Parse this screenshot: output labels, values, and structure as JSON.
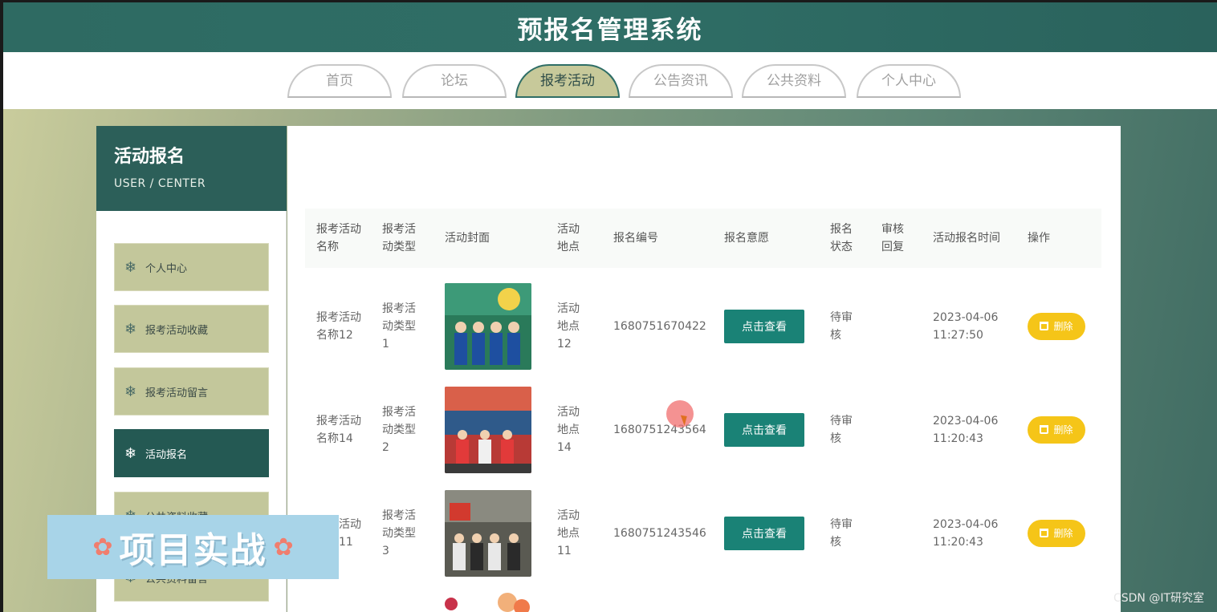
{
  "header": {
    "title": "预报名管理系统"
  },
  "nav": {
    "tabs": [
      "首页",
      "论坛",
      "报考活动",
      "公告资讯",
      "公共资料",
      "个人中心"
    ],
    "active": "报考活动"
  },
  "sidebar": {
    "title": "活动报名",
    "subtitle": "USER / CENTER",
    "items": [
      "个人中心",
      "报考活动收藏",
      "报考活动留言",
      "活动报名",
      "公共资料收藏",
      "公共资料留言"
    ],
    "active": "活动报名"
  },
  "table": {
    "headers": [
      "报考活动名称",
      "报考活动类型",
      "活动封面",
      "活动地点",
      "报名编号",
      "报名意愿",
      "报名状态",
      "审核回复",
      "活动报名时间",
      "操作"
    ],
    "view_label": "点击查看",
    "delete_label": "删除",
    "rows": [
      {
        "name": "报考活动名称12",
        "type": "报考活动类型1",
        "place": "活动地点12",
        "no": "1680751670422",
        "status": "待审核",
        "reply": "",
        "date": "2023-04-06",
        "time": "11:27:50"
      },
      {
        "name": "报考活动名称14",
        "type": "报考活动类型2",
        "place": "活动地点14",
        "no": "1680751243564",
        "status": "待审核",
        "reply": "",
        "date": "2023-04-06",
        "time": "11:20:43"
      },
      {
        "name": "报考活动名称11",
        "type": "报考活动类型3",
        "place": "活动地点11",
        "no": "1680751243546",
        "status": "待审核",
        "reply": "",
        "date": "2023-04-06",
        "time": "11:20:43"
      }
    ]
  },
  "banner": {
    "text": "项目实战"
  },
  "watermark": "CSDN @IT研究室",
  "colors": {
    "primary": "#2f6e66",
    "accent": "#c7c99a",
    "view_button": "#1a8276",
    "delete_button": "#f5c518"
  }
}
